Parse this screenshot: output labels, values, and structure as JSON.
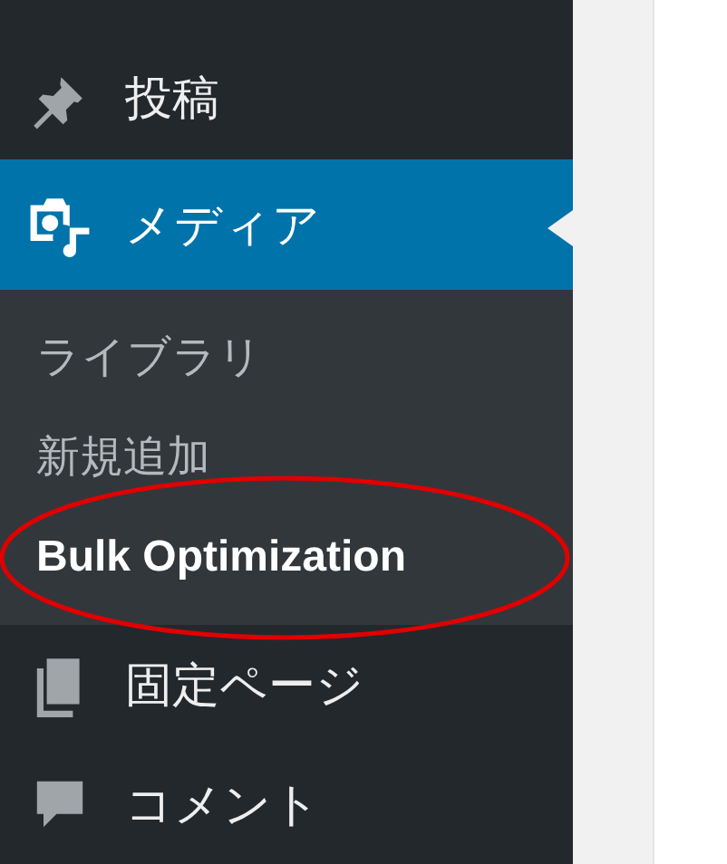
{
  "menu": [
    {
      "label": "投稿",
      "selected": false
    },
    {
      "label": "メディア",
      "selected": true,
      "children": [
        {
          "label": "ライブラリ",
          "selected": false
        },
        {
          "label": "新規追加",
          "selected": false
        },
        {
          "label": "Bulk Optimization",
          "selected": true
        }
      ]
    },
    {
      "label": "固定ページ",
      "selected": false
    },
    {
      "label": "コメント",
      "selected": false
    }
  ]
}
